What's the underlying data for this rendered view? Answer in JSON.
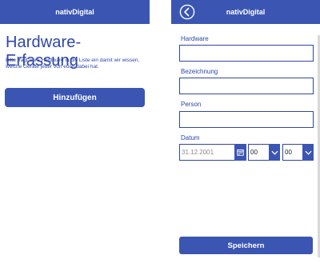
{
  "screen1": {
    "header_title": "nativDigital",
    "title": "Hardware-Erfassung",
    "description": "Bitte tragt eure Hardware in die Liste ein damit wir wissen, welche Geräte jeder von euch dabei hat.",
    "add_label": "Hinzufügen"
  },
  "screen2": {
    "header_title": "nativDigital",
    "back_icon": "back-arrow-circle-icon",
    "fields": {
      "hardware": {
        "label": "Hardware",
        "value": ""
      },
      "bezeichnung": {
        "label": "Bezeichnung",
        "value": ""
      },
      "person": {
        "label": "Person",
        "value": ""
      }
    },
    "datum": {
      "label": "Datum",
      "date_placeholder": "31.12.2001",
      "hour": "00",
      "minute": "00"
    },
    "save_label": "Speichern"
  },
  "colors": {
    "primary": "#3b55b3",
    "text_accent": "#2e47a6",
    "placeholder": "#8b8b8b"
  }
}
